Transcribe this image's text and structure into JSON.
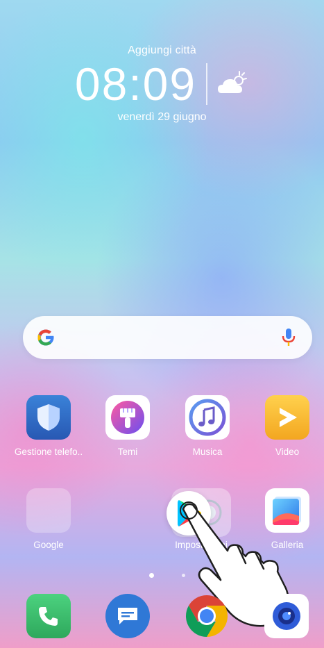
{
  "weather_widget": {
    "city": "Aggiungi città",
    "time": "08:09",
    "date": "venerdì 29 giugno",
    "icon": "partly-cloudy-icon"
  },
  "search_bar": {
    "icon_left": "google-g-icon",
    "icon_right": "microphone-icon"
  },
  "apps_row1": [
    {
      "label": "Gestione telefo..",
      "icon": "shield-icon"
    },
    {
      "label": "Temi",
      "icon": "paintbrush-icon"
    },
    {
      "label": "Musica",
      "icon": "music-note-icon"
    },
    {
      "label": "Video",
      "icon": "play-icon"
    }
  ],
  "apps_row2": [
    {
      "label": "Google",
      "icon": "folder-icon"
    },
    {
      "label": "Impostazioni",
      "icon": "settings-icon",
      "dragged_icon": "play-store-icon"
    },
    {
      "label": "Galleria",
      "icon": "gallery-icon"
    }
  ],
  "dock": [
    {
      "name": "phone",
      "icon": "phone-icon"
    },
    {
      "name": "messages",
      "icon": "chat-bubble-icon"
    },
    {
      "name": "chrome",
      "icon": "chrome-icon"
    },
    {
      "name": "camera",
      "icon": "camera-icon"
    }
  ],
  "page_indicator": {
    "current": 1,
    "total": 2
  },
  "colors": {
    "shield": "#2f74c9",
    "temi": "#7a62c9",
    "musica_ring": "#6a5cc9",
    "video": "#f6c130",
    "galleria": "#3d8ef0",
    "phone": "#3bb66d",
    "messages": "#2f78d6",
    "chrome_red": "#db4437",
    "chrome_yellow": "#f4b400",
    "chrome_green": "#0f9d58",
    "chrome_blue": "#4285f4"
  }
}
